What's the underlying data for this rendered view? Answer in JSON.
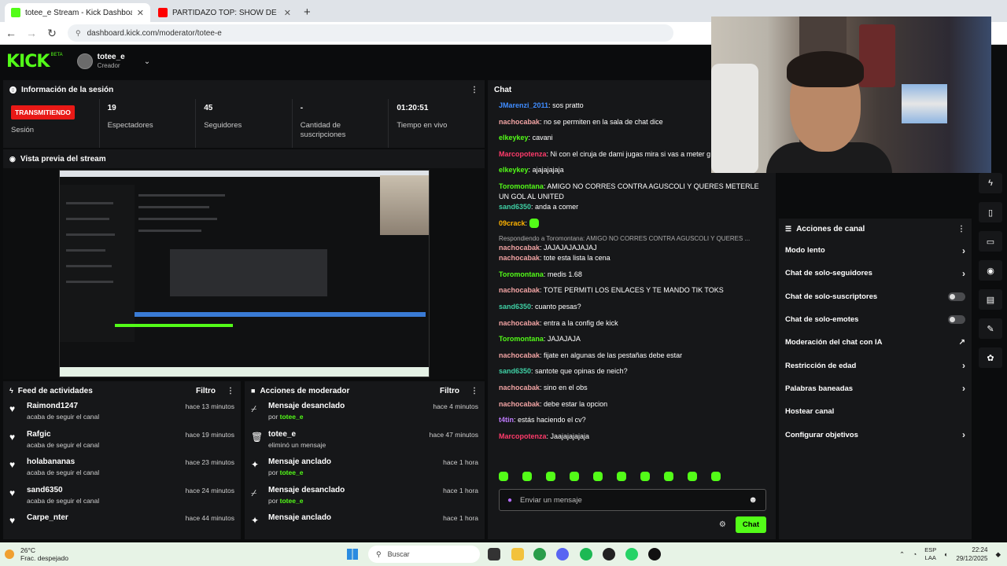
{
  "browser": {
    "tabs": [
      {
        "title": "totee_e Stream - Kick Dashboa",
        "color": "#53fc18",
        "active": true
      },
      {
        "title": "PARTIDAZO TOP: SHOW DE GO",
        "color": "#ff0000",
        "active": false
      }
    ],
    "url": "dashboard.kick.com/moderator/totee-e"
  },
  "header": {
    "logo": "KICK",
    "beta": "BETA",
    "username": "totee_e",
    "role": "Creador"
  },
  "session": {
    "title": "Información de la sesión",
    "badge": "TRANSMITIENDO",
    "badge_label": "Sesión",
    "stats": [
      {
        "value": "19",
        "label": "Espectadores"
      },
      {
        "value": "45",
        "label": "Seguidores"
      },
      {
        "value": "-",
        "label": "Cantidad de suscripciones"
      },
      {
        "value": "01:20:51",
        "label": "Tiempo en vivo"
      }
    ]
  },
  "preview": {
    "title": "Vista previa del stream"
  },
  "feed": {
    "title": "Feed de actividades",
    "filter": "Filtro",
    "items": [
      {
        "name": "Raimond1247",
        "sub": "acaba de seguir el canal",
        "time": "hace 13 minutos"
      },
      {
        "name": "Rafgic",
        "sub": "acaba de seguir el canal",
        "time": "hace 19 minutos"
      },
      {
        "name": "holabananas",
        "sub": "acaba de seguir el canal",
        "time": "hace 23 minutos"
      },
      {
        "name": "sand6350",
        "sub": "acaba de seguir el canal",
        "time": "hace 24 minutos"
      },
      {
        "name": "Carpe_nter",
        "sub": "",
        "time": "hace 44 minutos"
      }
    ]
  },
  "modactions": {
    "title": "Acciones de moderador",
    "filter": "Filtro",
    "items": [
      {
        "name": "Mensaje desanclado",
        "pre": "por ",
        "user": "totee_e",
        "time": "hace 4 minutos",
        "icon": "unpin-icon",
        "glyph": "⌿"
      },
      {
        "name": "totee_e",
        "pre": "eliminó un mensaje",
        "user": "",
        "time": "hace 47 minutos",
        "icon": "trash-icon",
        "glyph": "🗑"
      },
      {
        "name": "Mensaje anclado",
        "pre": "por ",
        "user": "totee_e",
        "time": "hace 1 hora",
        "icon": "pin-icon",
        "glyph": "📌"
      },
      {
        "name": "Mensaje desanclado",
        "pre": "por ",
        "user": "totee_e",
        "time": "hace 1 hora",
        "icon": "unpin-icon",
        "glyph": "⌿"
      },
      {
        "name": "Mensaje anclado",
        "pre": "",
        "user": "",
        "time": "hace 1 hora",
        "icon": "pin-icon",
        "glyph": "📌"
      }
    ]
  },
  "chat": {
    "title": "Chat",
    "messages": [
      {
        "user": "JMarenzi_2011",
        "color": "#3f8cff",
        "text": "sos pratto"
      },
      {
        "user": "nachocabak",
        "color": "#f1a3a3",
        "text": "no se permiten en la sala de chat dice"
      },
      {
        "user": "elkeykey",
        "color": "#53fc18",
        "text": "cavani"
      },
      {
        "user": "Marcopotenza",
        "color": "#ff3b6b",
        "text": "Ni con el ciruja de dami jugas mira si vas a meter g"
      },
      {
        "user": "elkeykey",
        "color": "#53fc18",
        "text": "ajajajajaja"
      },
      {
        "user": "Toromontana",
        "color": "#53fc18",
        "text": "AMIGO NO CORRES CONTRA AGUSCOLI Y QUERES METERLE UN GOL AL UNITED"
      },
      {
        "user": "sand6350",
        "color": "#3fd0a5",
        "text": "anda a comer"
      },
      {
        "user": "09crack",
        "color": "#ffb300",
        "text": "",
        "emote": true
      },
      {
        "reply": "Respondiendo a Toromontana: AMIGO NO CORRES CONTRA AGUSCOLI Y QUERES ...",
        "user": "nachocabak",
        "color": "#f1a3a3",
        "text": "JAJAJAJAJAJAJ"
      },
      {
        "user": "nachocabak",
        "color": "#f1a3a3",
        "text": "tote esta lista la cena"
      },
      {
        "user": "Toromontana",
        "color": "#53fc18",
        "text": "medis 1.68"
      },
      {
        "user": "nachocabak",
        "color": "#f1a3a3",
        "text": "TOTE PERMITI LOS ENLACES Y TE MANDO TIK TOKS"
      },
      {
        "user": "sand6350",
        "color": "#3fd0a5",
        "text": "cuanto pesas?"
      },
      {
        "user": "nachocabak",
        "color": "#f1a3a3",
        "text": "entra a la config de kick"
      },
      {
        "user": "Toromontana",
        "color": "#53fc18",
        "text": "JAJAJAJA"
      },
      {
        "user": "nachocabak",
        "color": "#f1a3a3",
        "text": "fijate en algunas de las pestañas debe estar"
      },
      {
        "user": "sand6350",
        "color": "#3fd0a5",
        "text": "santote que opinas de neich?"
      },
      {
        "user": "nachocabak",
        "color": "#f1a3a3",
        "text": "sino en el obs"
      },
      {
        "user": "nachocabak",
        "color": "#f1a3a3",
        "text": "debe estar la opcion"
      },
      {
        "user": "t4tin",
        "color": "#c07cff",
        "text": "estás haciendo el cv?"
      },
      {
        "user": "Marcopotenza",
        "color": "#ff3b6b",
        "text": "Jaajajajajaja"
      }
    ],
    "placeholder": "Enviar un mensaje",
    "send": "Chat"
  },
  "channel_actions": {
    "title": "Acciones de canal",
    "items": [
      {
        "label": "Modo lento",
        "type": "arrow"
      },
      {
        "label": "Chat de solo-seguidores",
        "type": "arrow"
      },
      {
        "label": "Chat de solo-suscriptores",
        "type": "toggle",
        "on": false
      },
      {
        "label": "Chat de solo-emotes",
        "type": "toggle",
        "on": false
      },
      {
        "label": "Moderación del chat con IA",
        "type": "external"
      },
      {
        "label": "Restricción de edad",
        "type": "arrow"
      },
      {
        "label": "Palabras baneadas",
        "type": "arrow"
      },
      {
        "label": "Hostear canal",
        "type": "none"
      },
      {
        "label": "Configurar objetivos",
        "type": "arrow"
      }
    ]
  },
  "taskbar": {
    "temp": "26°C",
    "weather": "Frac. despejado",
    "search": "Buscar",
    "lang1": "ESP",
    "lang2": "LAA",
    "time": "22:24",
    "date": "29/12/2025"
  }
}
